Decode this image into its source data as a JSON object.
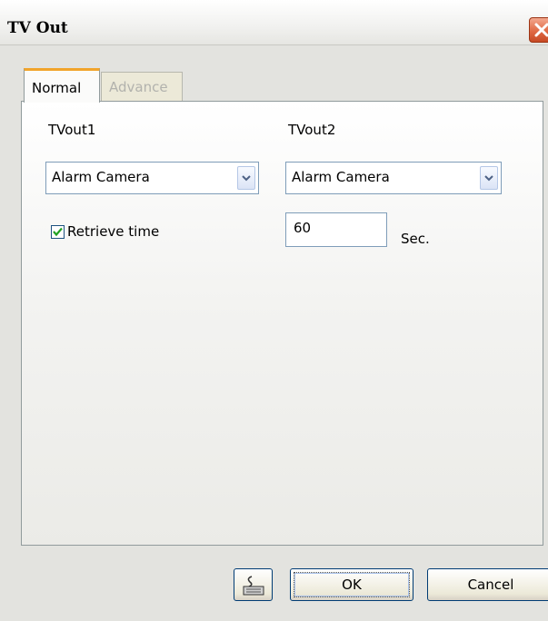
{
  "window": {
    "title": "TV Out"
  },
  "tabs": [
    {
      "label": "Normal",
      "active": true
    },
    {
      "label": "Advance",
      "active": false
    }
  ],
  "normal": {
    "tvout1": {
      "label": "TVout1",
      "selected": "Alarm Camera"
    },
    "tvout2": {
      "label": "TVout2",
      "selected": "Alarm Camera"
    },
    "retrieve_time": {
      "label": "Retrieve time",
      "checked": true,
      "value": "60",
      "unit": "Sec."
    }
  },
  "buttons": {
    "keyboard_icon": "keyboard-icon",
    "ok": "OK",
    "cancel": "Cancel"
  },
  "colors": {
    "tab_accent": "#f1a42b",
    "close_button": "#e06a45",
    "checkmark": "#21a121"
  }
}
